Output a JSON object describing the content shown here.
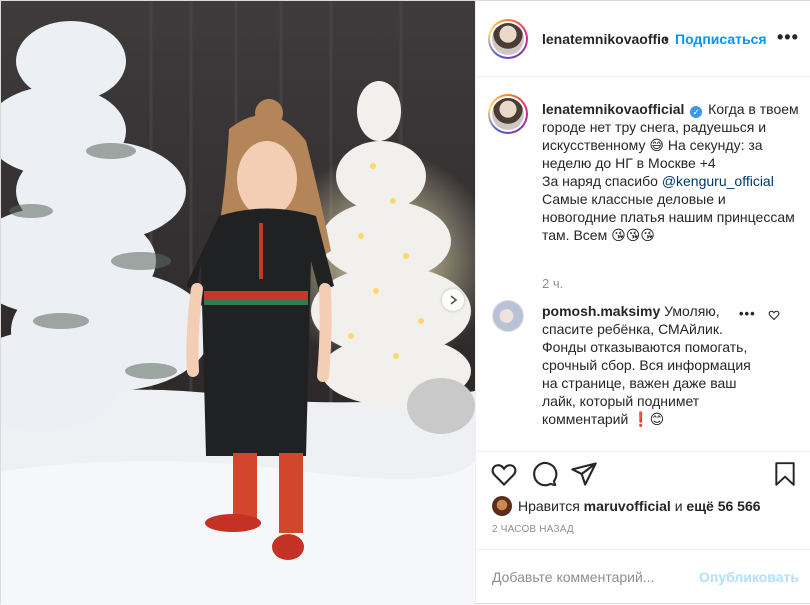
{
  "header": {
    "username": "lenatemnikovaoffic",
    "separator": "•",
    "follow_label": "Подписаться",
    "more_label": "•••"
  },
  "caption": {
    "username": "lenatemnikovaofficial",
    "verified_mark": "✓",
    "line_1": "Когда в твоем городе нет тру снега, радуешься и искусственному 😅 На секунду: за неделю до НГ в Москве +4",
    "line_2_prefix": "За наряд спасибо ",
    "mention": "@kenguru_official",
    "line_3": "Самые классные деловые и новогодние платья нашим принцессам там. Всем 😘😘😘",
    "time_ago": "2 ч."
  },
  "comment": {
    "username": "pomosh.maksimy",
    "text": "Умоляю, спасите ребёнка, СМАйлик. Фонды отказываются помогать, срочный сбор. Вся информация на странице, важен даже ваш лайк, который поднимет комментарий ❗😊",
    "more_label": "•••"
  },
  "actions": {
    "icons": [
      "heart-icon",
      "comment-icon",
      "share-icon",
      "bookmark-icon"
    ],
    "likes_prefix": "Нравится ",
    "liker": "maruvofficial",
    "likes_middle": " и ",
    "likes_rest": "ещё 56 566",
    "timestamp": "2 часов назад"
  },
  "add_comment": {
    "placeholder": "Добавьте комментарий...",
    "publish_label": "Опубликовать"
  },
  "colors": {
    "accent": "#0095f6",
    "publish_disabled": "#b2dffc",
    "text": "#262626",
    "muted": "#8e8e8e"
  }
}
